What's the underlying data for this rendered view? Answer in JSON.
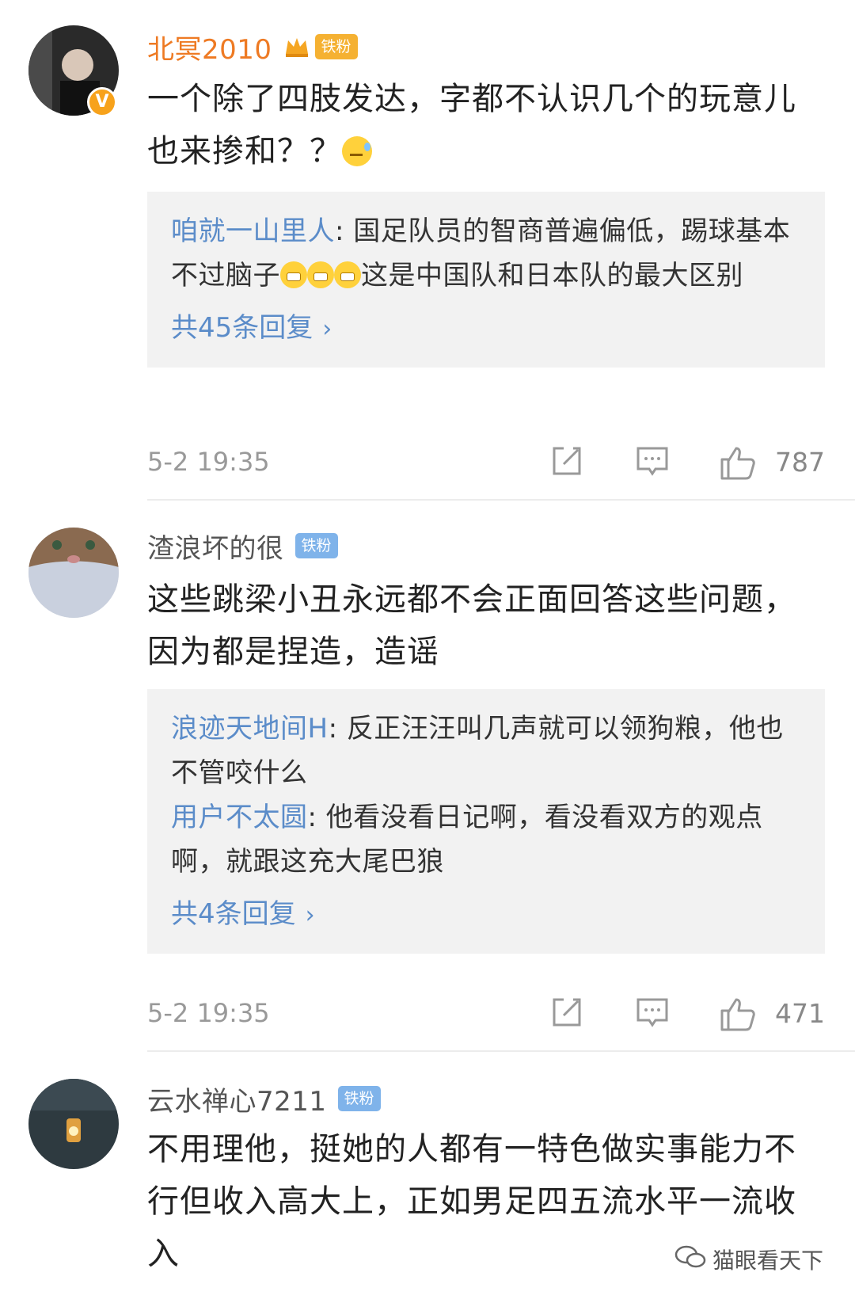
{
  "comments": [
    {
      "username": "北冥2010",
      "badge": "铁粉",
      "verified_mark": "V",
      "text_parts": [
        "一个除了四肢发达，字都不认识几个的玩意儿也来掺和？？"
      ],
      "emoji": "sweat-emoji",
      "replies": [
        {
          "name": "咱就一山里人",
          "text": ": 国足队员的智商普遍偏低，踢球基本不过脑子",
          "text_after": "这是中国队和日本队的最大区别"
        }
      ],
      "more_replies": "共45条回复",
      "time": "5-2 19:35",
      "likes": "787"
    },
    {
      "username": "渣浪坏的很",
      "badge": "铁粉",
      "text_parts": [
        "这些跳梁小丑永远都不会正面回答这些问题，因为都是捏造，造谣"
      ],
      "replies": [
        {
          "name": "浪迹天地间H",
          "text": ": 反正汪汪叫几声就可以领狗粮，他也不管咬什么"
        },
        {
          "name": "用户不太圆",
          "text": ": 他看没看日记啊，看没看双方的观点啊，就跟这充大尾巴狼"
        }
      ],
      "more_replies": "共4条回复",
      "time": "5-2 19:35",
      "likes": "471"
    },
    {
      "username": "云水禅心7211",
      "badge": "铁粉",
      "text_parts": [
        "不用理他，挺她的人都有一特色做实事能力不行但收入高大上，正如男足四五流水平一流收入"
      ]
    }
  ],
  "watermark": "猫眼看天下",
  "colors": {
    "vip_name": "#ee7a23",
    "link": "#5b8cc9",
    "reply_bg": "#f2f2f2"
  }
}
